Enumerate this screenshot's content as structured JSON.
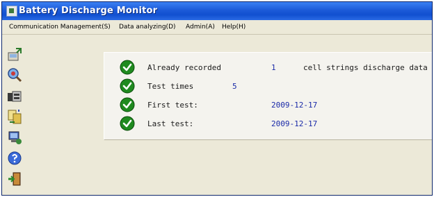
{
  "window": {
    "title": "Battery Discharge Monitor"
  },
  "menubar": {
    "items": [
      {
        "label": "Communication Management(S)"
      },
      {
        "label": "Data analyzing(D)"
      },
      {
        "label": "Admin(A)"
      },
      {
        "label": "Help(H)"
      }
    ]
  },
  "toolbar": {
    "tools": [
      {
        "icon": "communication-icon"
      },
      {
        "icon": "analysis-icon"
      },
      {
        "icon": "battery-test-icon"
      },
      {
        "icon": "data-transfer-icon"
      },
      {
        "icon": "settings-icon"
      },
      {
        "icon": "help-icon"
      },
      {
        "icon": "exit-icon"
      }
    ]
  },
  "summary": {
    "recorded_label": "Already recorded",
    "recorded_value": "1",
    "recorded_suffix": "cell strings discharge data",
    "test_times_label": "Test times",
    "test_times_value": "5",
    "first_test_label": "First test:",
    "first_test_value": "2009-12-17",
    "last_test_label": "Last test:",
    "last_test_value": "2009-12-17"
  },
  "colors": {
    "titlebar": "#1c5ad8",
    "value_text": "#1a2aa8",
    "check_green": "#1f8a1f"
  }
}
